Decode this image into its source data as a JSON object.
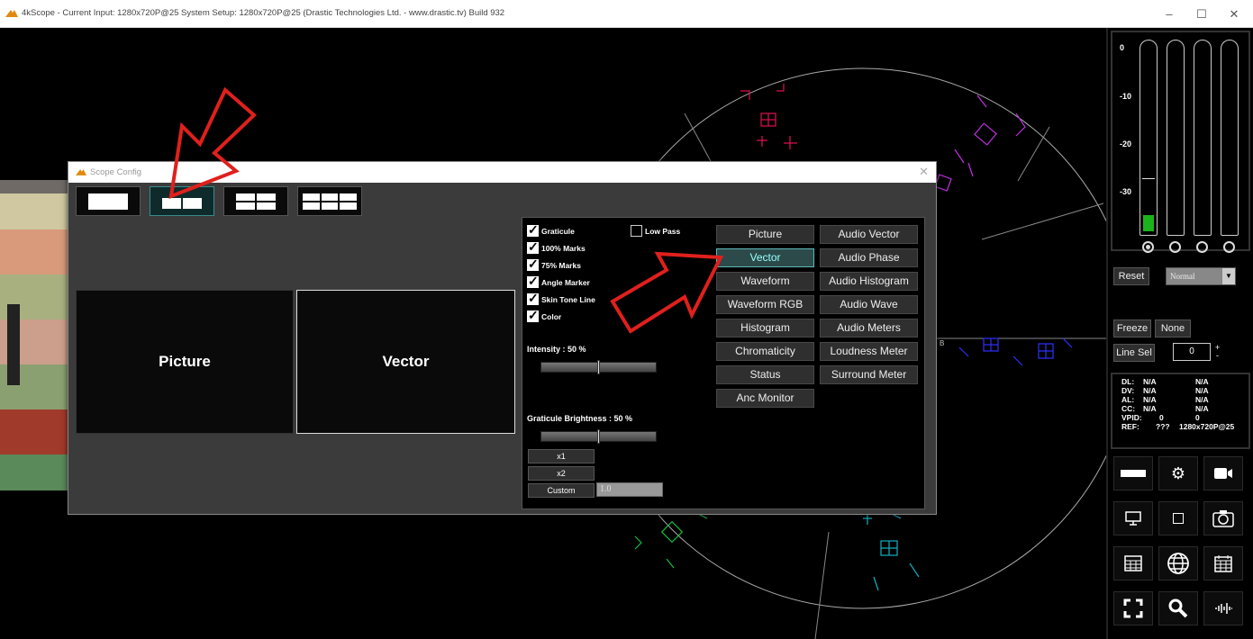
{
  "window": {
    "title": "4kScope -  Current Input: 1280x720P@25   System Setup: 1280x720P@25    (Drastic Technologies Ltd. - www.drastic.tv) Build 932",
    "minimize": "–",
    "maximize": "☐",
    "close": "✕"
  },
  "scope_bg": {
    "label_b": "B"
  },
  "right_panel": {
    "db_labels": [
      "0",
      "-10",
      "-20",
      "-30"
    ],
    "reset": "Reset",
    "mode_select": "Normal",
    "freeze": "Freeze",
    "none": "None",
    "line_sel": "Line Sel",
    "line_value": "0",
    "spin_up": "+",
    "spin_down": "-",
    "status": [
      {
        "k": "DL:",
        "v1": "N/A",
        "v2": "N/A"
      },
      {
        "k": "DV:",
        "v1": "N/A",
        "v2": "N/A"
      },
      {
        "k": "AL:",
        "v1": "N/A",
        "v2": "N/A"
      },
      {
        "k": "CC:",
        "v1": "N/A",
        "v2": "N/A"
      },
      {
        "k": "VPID:",
        "v1": "0",
        "v2": "0"
      },
      {
        "k": "REF:",
        "v1": "???",
        "v2": "1280x720P@25"
      }
    ],
    "icons": [
      "single-layout-icon",
      "gear-icon",
      "cast-icon",
      "monitor-icon",
      "square-icon",
      "camera-icon",
      "table-icon",
      "globe-icon",
      "calendar-icon",
      "fullscreen-icon",
      "search-icon",
      "audio-wave-icon"
    ]
  },
  "dialog": {
    "title": "Scope Config",
    "close": "✕",
    "panes": [
      "Picture",
      "Vector"
    ],
    "options": {
      "graticule": "Graticule",
      "low_pass": "Low Pass",
      "marks100": "100% Marks",
      "marks75": "75% Marks",
      "angle_marker": "Angle Marker",
      "skin_tone": "Skin Tone Line",
      "color": "Color",
      "intensity": "Intensity : 50 %",
      "intensity_value": 50,
      "graticule_brightness": "Graticule Brightness : 50 %",
      "graticule_brightness_value": 50,
      "x1": "x1",
      "x2": "x2",
      "custom": "Custom",
      "custom_value": "1.0"
    },
    "tools_col1": [
      "Picture",
      "Vector",
      "Waveform",
      "Waveform RGB",
      "Histogram",
      "Chromaticity",
      "Status",
      "Anc Monitor"
    ],
    "tools_col2": [
      "Audio Vector",
      "Audio Phase",
      "Audio Histogram",
      "Audio Wave",
      "Audio Meters",
      "Loudness Meter",
      "Surround Meter"
    ],
    "selected_tool": "Vector"
  },
  "colors": {
    "accent": "#5fb9b9",
    "annotation_arrow": "#e0201c",
    "meter_green": "#1bb31b"
  }
}
